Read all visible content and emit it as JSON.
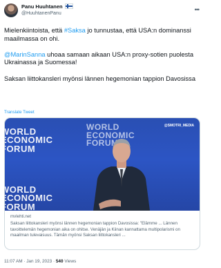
{
  "author": {
    "name": "Panu Huuhtanen",
    "flag": "Finnish flag",
    "handle": "@HuuhtanenPanu"
  },
  "tweet": {
    "p1_pre": "Mielenkiintoista, että ",
    "p1_hashtag": "#Saksa",
    "p1_post": " jo tunnustaa, että USA:n dominanssi maailmassa on ohi.",
    "p2_mention": "@MarinSanna",
    "p2_post": " uhoaa samaan aikaan USA:n proxy-sotien puolesta Ukrainassa ja Suomessa!",
    "p3": "Saksan liittokansleri myönsi lännen hegemonian tappion Davosissa",
    "translate": "Translate Tweet"
  },
  "card": {
    "image_brand_line1": "WORLD",
    "image_brand_line2": "ECONOMIC",
    "image_brand_line3": "FORUM",
    "watermark": "@SMOTRI_MEDIA",
    "domain": "mvlehti.net",
    "description": "Saksan liittokansleri myönsi lännen hegemonian tappion Davosissa: \"Elämme ... Lännen tavoittelemän hegemonian aika on ohitse. Venäjän ja Kiinan kannattama multipolarismi on maailman tulevaisuus. Tämän myönsi Saksan liittokansleri ..."
  },
  "meta": {
    "time": "11:07 AM",
    "date": "Jan 19, 2023",
    "views_count": "540",
    "views_label": "Views"
  },
  "colors": {
    "link": "#1d9bf0",
    "secondary_text": "#536471",
    "wef_blue": "#2c55c4"
  }
}
